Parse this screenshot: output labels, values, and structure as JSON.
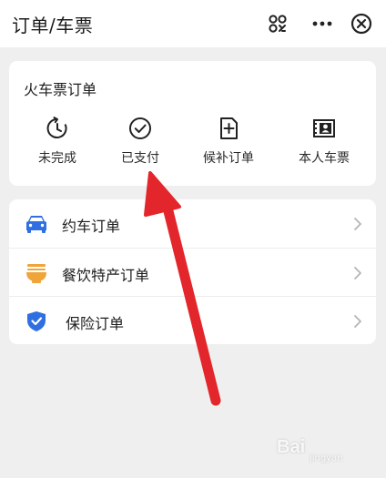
{
  "header": {
    "title": "订单/车票",
    "icons": [
      "scan-icon",
      "more-icon",
      "close-icon"
    ]
  },
  "train_card": {
    "title": "火车票订单",
    "shortcuts": [
      {
        "label": "未完成",
        "icon": "clock-refresh-icon"
      },
      {
        "label": "已支付",
        "icon": "check-circle-icon"
      },
      {
        "label": "候补订单",
        "icon": "add-document-icon"
      },
      {
        "label": "本人车票",
        "icon": "id-card-icon"
      }
    ]
  },
  "list": {
    "items": [
      {
        "label": "约车订单",
        "icon": "car-icon",
        "color": "#2f6fe0"
      },
      {
        "label": "餐饮特产订单",
        "icon": "food-bowl-icon",
        "color": "#f0a53a"
      },
      {
        "label": "保险订单",
        "icon": "shield-check-icon",
        "color": "#2f6fe0"
      }
    ]
  },
  "annotation": {
    "color": "#e3262b"
  },
  "watermark": {
    "text": "Bai",
    "sub": "jingyan"
  }
}
